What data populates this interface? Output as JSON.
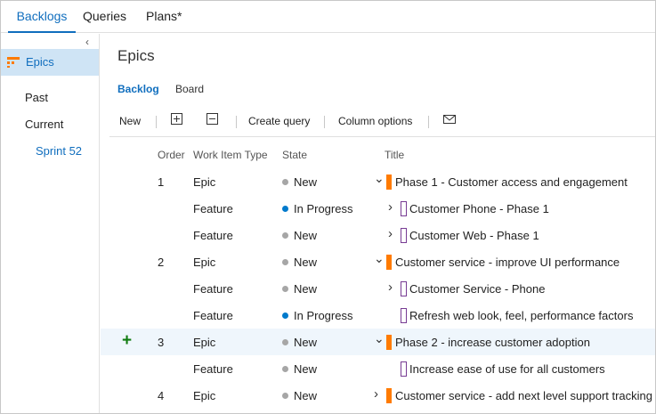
{
  "top_tabs": [
    {
      "label": "Backlogs",
      "active": true
    },
    {
      "label": "Queries",
      "active": false
    },
    {
      "label": "Plans*",
      "active": false
    }
  ],
  "sidebar": {
    "collapse_glyph": "‹",
    "epics_label": "Epics",
    "past_label": "Past",
    "current_label": "Current",
    "sprint_label": "Sprint 52"
  },
  "main": {
    "title": "Epics",
    "tabs": [
      {
        "label": "Backlog",
        "active": true
      },
      {
        "label": "Board",
        "active": false
      }
    ]
  },
  "toolbar": {
    "new_label": "New",
    "create_query_label": "Create query",
    "column_options_label": "Column options"
  },
  "columns": {
    "order": "Order",
    "type": "Work Item Type",
    "state": "State",
    "title": "Title"
  },
  "colors": {
    "accent": "#106ebe",
    "epic": "#ff7b00",
    "feature": "#773b93",
    "new_state": "#a6a6a6",
    "in_progress_state": "#007acc"
  },
  "rows": [
    {
      "order": "1",
      "type": "Epic",
      "state": "New",
      "title": "Phase 1 - Customer access and engagement"
    },
    {
      "order": "",
      "type": "Feature",
      "state": "In Progress",
      "title": "Customer Phone - Phase 1"
    },
    {
      "order": "",
      "type": "Feature",
      "state": "New",
      "title": "Customer Web - Phase 1"
    },
    {
      "order": "2",
      "type": "Epic",
      "state": "New",
      "title": "Customer service - improve UI performance"
    },
    {
      "order": "",
      "type": "Feature",
      "state": "New",
      "title": "Customer Service - Phone"
    },
    {
      "order": "",
      "type": "Feature",
      "state": "In Progress",
      "title": "Refresh web look, feel, performance factors"
    },
    {
      "order": "3",
      "type": "Epic",
      "state": "New",
      "title": "Phase 2 - increase customer adoption"
    },
    {
      "order": "",
      "type": "Feature",
      "state": "New",
      "title": "Increase ease of use for all customers"
    },
    {
      "order": "4",
      "type": "Epic",
      "state": "New",
      "title": "Customer service - add next level support tracking"
    }
  ]
}
